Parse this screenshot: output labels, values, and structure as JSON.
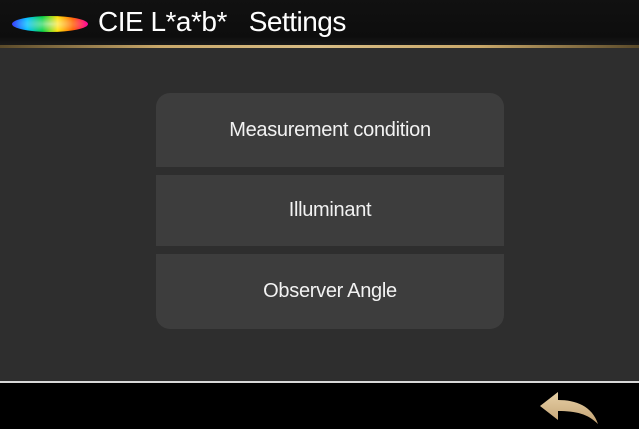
{
  "header": {
    "title": "CIE L*a*b*   Settings",
    "logo_icon": "color-spectrum-oval-icon"
  },
  "menu": {
    "items": [
      {
        "label": "Measurement condition"
      },
      {
        "label": "Illuminant"
      },
      {
        "label": "Observer Angle"
      }
    ]
  },
  "footer": {
    "back_icon": "back-arrow-icon"
  },
  "colors": {
    "background": "#2e2e2e",
    "header_bar": "#111111",
    "accent_gold": "#c9a86a",
    "menu_item": "#3d3d3d",
    "back_arrow": "#d9bf91"
  }
}
